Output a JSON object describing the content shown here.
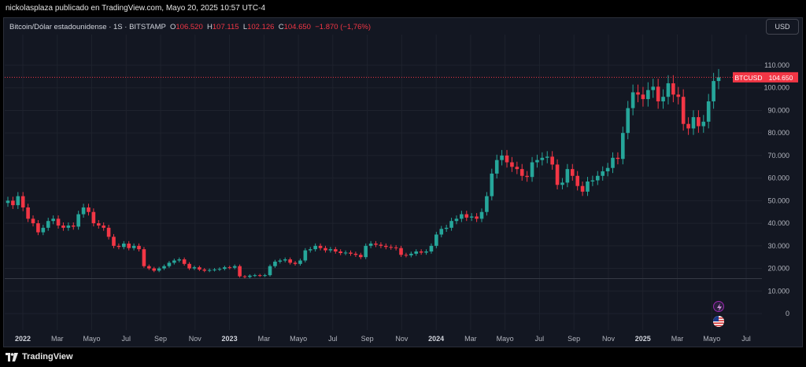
{
  "header": {
    "publisher": "nickolasplaza publicado en TradingView.com, Mayo 20, 2025 10:57 UTC-4"
  },
  "legend": {
    "symbol": "Bitcoin/Dólar estadounidense · 1S · BITSTAMP",
    "open_label": "O",
    "open": "106.520",
    "high_label": "H",
    "high": "107.115",
    "low_label": "L",
    "low": "102.126",
    "close_label": "C",
    "close": "104.650",
    "change": "−1.870 (−1,76%)"
  },
  "currency_button": "USD",
  "price_tag": {
    "symbol": "BTCUSD",
    "value": "104.650"
  },
  "footer": {
    "brand": "TradingView"
  },
  "icons": {
    "lightning": "lightning-icon",
    "flag": "us-flag-icon"
  },
  "colors": {
    "up": "#26a69a",
    "down": "#f23645",
    "background": "#131722",
    "grid": "#1e222d"
  },
  "chart_data": {
    "type": "candlestick",
    "interval": "weekly",
    "y_axis": {
      "min": 0,
      "max": 110000,
      "ticks": [
        "110.000",
        "100.000",
        "90.000",
        "80.000",
        "70.000",
        "60.000",
        "50.000",
        "40.000",
        "30.000",
        "20.000",
        "10.000",
        "0"
      ]
    },
    "x_ticks": [
      {
        "label": "2022",
        "bold": true
      },
      {
        "label": "Mar"
      },
      {
        "label": "Mayo"
      },
      {
        "label": "Jul"
      },
      {
        "label": "Sep"
      },
      {
        "label": "Nov"
      },
      {
        "label": "2023",
        "bold": true
      },
      {
        "label": "Mar"
      },
      {
        "label": "Mayo"
      },
      {
        "label": "Jul"
      },
      {
        "label": "Sep"
      },
      {
        "label": "Nov"
      },
      {
        "label": "2024",
        "bold": true
      },
      {
        "label": "Mar"
      },
      {
        "label": "Mayo"
      },
      {
        "label": "Jul"
      },
      {
        "label": "Sep"
      },
      {
        "label": "Nov"
      },
      {
        "label": "2025",
        "bold": true
      },
      {
        "label": "Mar"
      },
      {
        "label": "Mayo"
      },
      {
        "label": "Jul"
      }
    ],
    "last_price": 104650,
    "reference_level": 15500,
    "closes": [
      50000,
      48000,
      52000,
      47000,
      42000,
      40000,
      36000,
      38000,
      41000,
      42000,
      39000,
      38000,
      39000,
      38500,
      44000,
      47000,
      45000,
      40000,
      39000,
      38000,
      34000,
      30000,
      29500,
      31000,
      29000,
      30000,
      28500,
      21000,
      20000,
      19000,
      20000,
      21000,
      22500,
      23500,
      24000,
      22000,
      20000,
      20500,
      19500,
      19000,
      19300,
      19500,
      19800,
      20500,
      20300,
      21000,
      16500,
      16200,
      16800,
      17000,
      16800,
      17000,
      21000,
      23000,
      23500,
      24000,
      22500,
      22000,
      23500,
      28000,
      28500,
      30000,
      29000,
      28000,
      28500,
      27500,
      26800,
      27000,
      26500,
      26000,
      25000,
      30000,
      31000,
      30500,
      30000,
      29500,
      29300,
      29000,
      26000,
      25800,
      26500,
      27500,
      27000,
      27500,
      30000,
      35000,
      37500,
      38000,
      41000,
      42000,
      44000,
      42500,
      43000,
      42000,
      45000,
      52000,
      62000,
      68000,
      70000,
      67000,
      65000,
      64000,
      61000,
      60500,
      67000,
      68000,
      69000,
      69500,
      66000,
      57000,
      58000,
      64000,
      61000,
      56500,
      54000,
      58500,
      59000,
      61000,
      63000,
      64500,
      69000,
      68500,
      80000,
      91000,
      98000,
      97000,
      95000,
      99000,
      100500,
      94000,
      96000,
      102000,
      97000,
      96000,
      84000,
      82000,
      87000,
      83000,
      85000,
      94000,
      103000,
      104650
    ]
  }
}
